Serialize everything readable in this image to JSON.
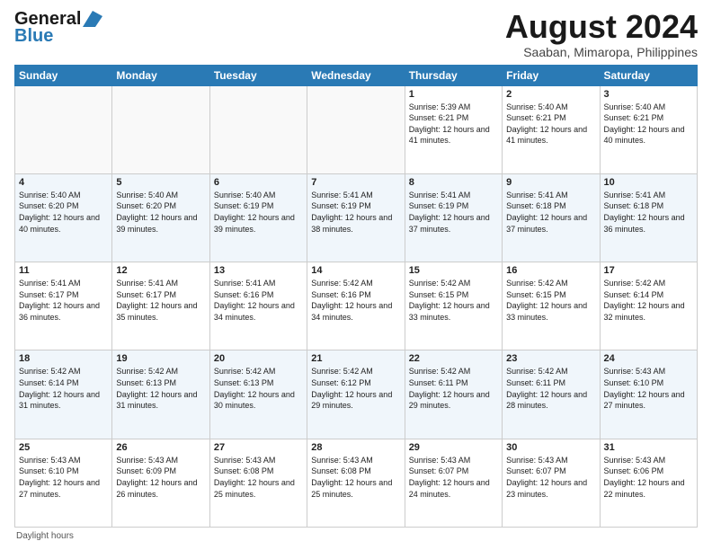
{
  "header": {
    "logo_line1": "General",
    "logo_line2": "Blue",
    "month_year": "August 2024",
    "location": "Saaban, Mimaropa, Philippines"
  },
  "days_of_week": [
    "Sunday",
    "Monday",
    "Tuesday",
    "Wednesday",
    "Thursday",
    "Friday",
    "Saturday"
  ],
  "footer_label": "Daylight hours",
  "weeks": [
    [
      {
        "day": "",
        "empty": true
      },
      {
        "day": "",
        "empty": true
      },
      {
        "day": "",
        "empty": true
      },
      {
        "day": "",
        "empty": true
      },
      {
        "day": "1",
        "sunrise": "5:39 AM",
        "sunset": "6:21 PM",
        "daylight": "12 hours and 41 minutes."
      },
      {
        "day": "2",
        "sunrise": "5:40 AM",
        "sunset": "6:21 PM",
        "daylight": "12 hours and 41 minutes."
      },
      {
        "day": "3",
        "sunrise": "5:40 AM",
        "sunset": "6:21 PM",
        "daylight": "12 hours and 40 minutes."
      }
    ],
    [
      {
        "day": "4",
        "sunrise": "5:40 AM",
        "sunset": "6:20 PM",
        "daylight": "12 hours and 40 minutes."
      },
      {
        "day": "5",
        "sunrise": "5:40 AM",
        "sunset": "6:20 PM",
        "daylight": "12 hours and 39 minutes."
      },
      {
        "day": "6",
        "sunrise": "5:40 AM",
        "sunset": "6:19 PM",
        "daylight": "12 hours and 39 minutes."
      },
      {
        "day": "7",
        "sunrise": "5:41 AM",
        "sunset": "6:19 PM",
        "daylight": "12 hours and 38 minutes."
      },
      {
        "day": "8",
        "sunrise": "5:41 AM",
        "sunset": "6:19 PM",
        "daylight": "12 hours and 37 minutes."
      },
      {
        "day": "9",
        "sunrise": "5:41 AM",
        "sunset": "6:18 PM",
        "daylight": "12 hours and 37 minutes."
      },
      {
        "day": "10",
        "sunrise": "5:41 AM",
        "sunset": "6:18 PM",
        "daylight": "12 hours and 36 minutes."
      }
    ],
    [
      {
        "day": "11",
        "sunrise": "5:41 AM",
        "sunset": "6:17 PM",
        "daylight": "12 hours and 36 minutes."
      },
      {
        "day": "12",
        "sunrise": "5:41 AM",
        "sunset": "6:17 PM",
        "daylight": "12 hours and 35 minutes."
      },
      {
        "day": "13",
        "sunrise": "5:41 AM",
        "sunset": "6:16 PM",
        "daylight": "12 hours and 34 minutes."
      },
      {
        "day": "14",
        "sunrise": "5:42 AM",
        "sunset": "6:16 PM",
        "daylight": "12 hours and 34 minutes."
      },
      {
        "day": "15",
        "sunrise": "5:42 AM",
        "sunset": "6:15 PM",
        "daylight": "12 hours and 33 minutes."
      },
      {
        "day": "16",
        "sunrise": "5:42 AM",
        "sunset": "6:15 PM",
        "daylight": "12 hours and 33 minutes."
      },
      {
        "day": "17",
        "sunrise": "5:42 AM",
        "sunset": "6:14 PM",
        "daylight": "12 hours and 32 minutes."
      }
    ],
    [
      {
        "day": "18",
        "sunrise": "5:42 AM",
        "sunset": "6:14 PM",
        "daylight": "12 hours and 31 minutes."
      },
      {
        "day": "19",
        "sunrise": "5:42 AM",
        "sunset": "6:13 PM",
        "daylight": "12 hours and 31 minutes."
      },
      {
        "day": "20",
        "sunrise": "5:42 AM",
        "sunset": "6:13 PM",
        "daylight": "12 hours and 30 minutes."
      },
      {
        "day": "21",
        "sunrise": "5:42 AM",
        "sunset": "6:12 PM",
        "daylight": "12 hours and 29 minutes."
      },
      {
        "day": "22",
        "sunrise": "5:42 AM",
        "sunset": "6:11 PM",
        "daylight": "12 hours and 29 minutes."
      },
      {
        "day": "23",
        "sunrise": "5:42 AM",
        "sunset": "6:11 PM",
        "daylight": "12 hours and 28 minutes."
      },
      {
        "day": "24",
        "sunrise": "5:43 AM",
        "sunset": "6:10 PM",
        "daylight": "12 hours and 27 minutes."
      }
    ],
    [
      {
        "day": "25",
        "sunrise": "5:43 AM",
        "sunset": "6:10 PM",
        "daylight": "12 hours and 27 minutes."
      },
      {
        "day": "26",
        "sunrise": "5:43 AM",
        "sunset": "6:09 PM",
        "daylight": "12 hours and 26 minutes."
      },
      {
        "day": "27",
        "sunrise": "5:43 AM",
        "sunset": "6:08 PM",
        "daylight": "12 hours and 25 minutes."
      },
      {
        "day": "28",
        "sunrise": "5:43 AM",
        "sunset": "6:08 PM",
        "daylight": "12 hours and 25 minutes."
      },
      {
        "day": "29",
        "sunrise": "5:43 AM",
        "sunset": "6:07 PM",
        "daylight": "12 hours and 24 minutes."
      },
      {
        "day": "30",
        "sunrise": "5:43 AM",
        "sunset": "6:07 PM",
        "daylight": "12 hours and 23 minutes."
      },
      {
        "day": "31",
        "sunrise": "5:43 AM",
        "sunset": "6:06 PM",
        "daylight": "12 hours and 22 minutes."
      }
    ]
  ]
}
